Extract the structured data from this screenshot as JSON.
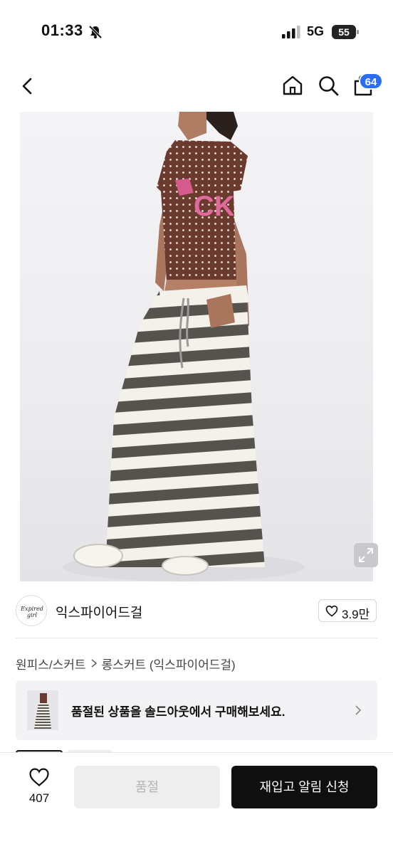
{
  "status_bar": {
    "time": "01:33",
    "network": "5G",
    "battery": "55"
  },
  "header": {
    "cart_badge": "64"
  },
  "brand": {
    "name": "익스파이어드걸",
    "logo_text": "Expired girl",
    "likes": "3.9만"
  },
  "breadcrumb": {
    "items": [
      "원피스/스커트",
      "롱스커트 (익스파이어드걸)"
    ]
  },
  "soldout_banner": {
    "text": "품절된 상품을 솔드아웃에서 구매해보세요."
  },
  "bottom_bar": {
    "wish_count": "407",
    "soldout_label": "품절",
    "restock_label": "재입고 알림 신청"
  },
  "colors": {
    "badge": "#2c6ef2",
    "primary_button": "#0f0f0f",
    "disabled_button": "#eeeeee"
  }
}
